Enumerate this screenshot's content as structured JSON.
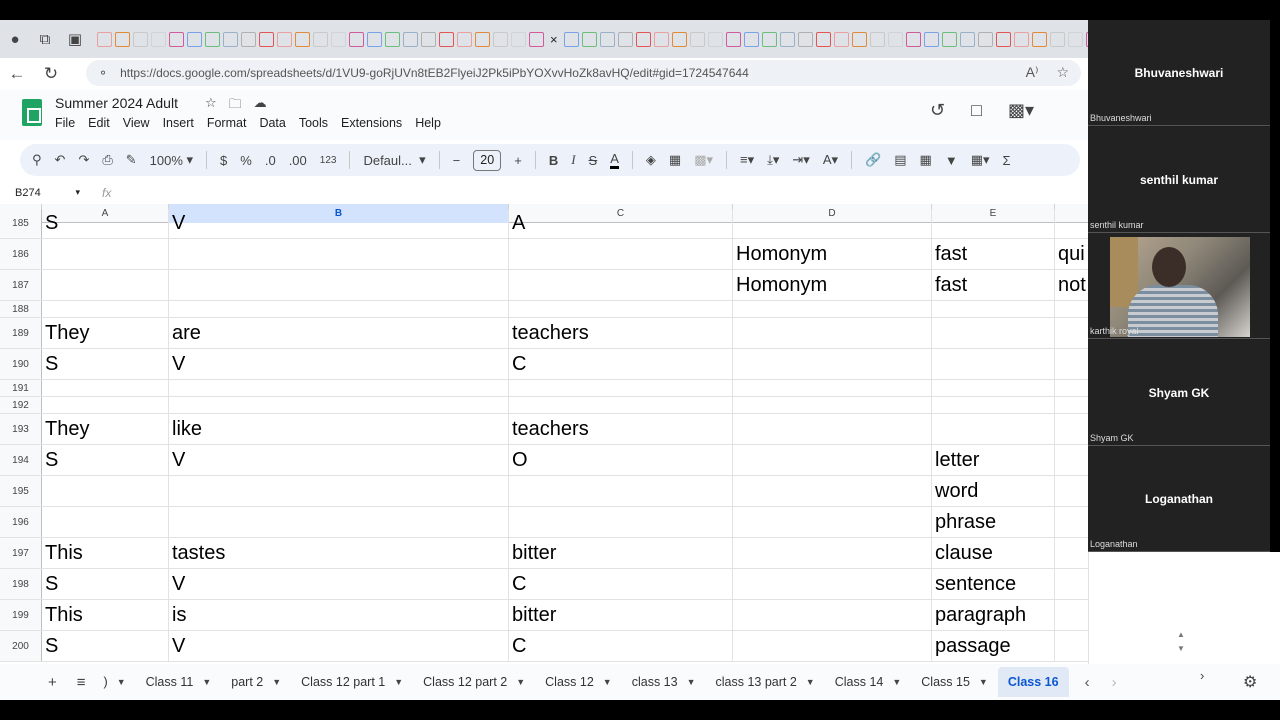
{
  "browser": {
    "url": "https://docs.google.com/spreadsheets/d/1VU9-goRjUVn8tEB2FlyeiJ2Pk5iPbYOXvvHoZk8avHQ/edit#gid=1724547644",
    "tab_close": "×"
  },
  "doc": {
    "title": "Summer 2024 Adult",
    "menu": [
      "File",
      "Edit",
      "View",
      "Insert",
      "Format",
      "Data",
      "Tools",
      "Extensions",
      "Help"
    ]
  },
  "toolbar": {
    "zoom": "100%",
    "currency": "$",
    "percent": "%",
    "dec_decrease": ".0",
    "dec_increase": ".00",
    "number_format": "123",
    "font": "Defaul...",
    "font_size": "20",
    "bold": "B",
    "italic": "I",
    "strike": "S",
    "text_color": "A"
  },
  "formula_bar": {
    "cell_ref": "B274",
    "fx": "fx",
    "value": ""
  },
  "grid": {
    "columns": [
      {
        "label": "A",
        "selected": false
      },
      {
        "label": "B",
        "selected": true
      },
      {
        "label": "C",
        "selected": false
      },
      {
        "label": "D",
        "selected": false
      },
      {
        "label": "E",
        "selected": false
      },
      {
        "label": "",
        "selected": false
      }
    ],
    "rows": [
      {
        "num": "185",
        "cells": [
          "S",
          "V",
          "A",
          "",
          "",
          ""
        ]
      },
      {
        "num": "186",
        "cells": [
          "",
          "",
          "",
          "Homonym",
          "fast",
          "qui"
        ]
      },
      {
        "num": "187",
        "cells": [
          "",
          "",
          "",
          "Homonym",
          "fast",
          "not"
        ]
      },
      {
        "num": "188",
        "cells": [
          "",
          "",
          "",
          "",
          "",
          ""
        ]
      },
      {
        "num": "189",
        "cells": [
          "They",
          "are",
          "teachers",
          "",
          "",
          ""
        ]
      },
      {
        "num": "190",
        "cells": [
          "S",
          "V",
          "C",
          "",
          "",
          ""
        ]
      },
      {
        "num": "191",
        "cells": [
          "",
          "",
          "",
          "",
          "",
          ""
        ]
      },
      {
        "num": "192",
        "cells": [
          "",
          "",
          "",
          "",
          "",
          ""
        ]
      },
      {
        "num": "193",
        "cells": [
          "They",
          "like",
          "teachers",
          "",
          "",
          ""
        ]
      },
      {
        "num": "194",
        "cells": [
          "S",
          "V",
          "O",
          "",
          "letter",
          ""
        ]
      },
      {
        "num": "195",
        "cells": [
          "",
          "",
          "",
          "",
          "word",
          ""
        ]
      },
      {
        "num": "196",
        "cells": [
          "",
          "",
          "",
          "",
          "phrase",
          ""
        ]
      },
      {
        "num": "197",
        "cells": [
          "This",
          "tastes",
          "bitter",
          "",
          "clause",
          ""
        ]
      },
      {
        "num": "198",
        "cells": [
          "S",
          "V",
          "C",
          "",
          "sentence",
          ""
        ]
      },
      {
        "num": "199",
        "cells": [
          "This",
          "is",
          "bitter",
          "",
          "paragraph",
          ""
        ]
      },
      {
        "num": "200",
        "cells": [
          "S",
          "V",
          "C",
          "",
          "passage",
          ""
        ]
      }
    ]
  },
  "sheets": {
    "tabs": [
      {
        "label": ")",
        "active": false
      },
      {
        "label": "Class 11",
        "active": false
      },
      {
        "label": "part 2",
        "active": false
      },
      {
        "label": "Class 12 part 1",
        "active": false
      },
      {
        "label": "Class 12 part 2",
        "active": false
      },
      {
        "label": "Class 12",
        "active": false
      },
      {
        "label": "class 13",
        "active": false
      },
      {
        "label": "class 13 part 2",
        "active": false
      },
      {
        "label": "Class 14",
        "active": false
      },
      {
        "label": "Class 15",
        "active": false
      },
      {
        "label": "Class 16",
        "active": true
      }
    ]
  },
  "meeting": {
    "participants": [
      {
        "name": "Bhuvaneshwari",
        "label": "Bhuvaneshwari",
        "video": false
      },
      {
        "name": "senthil kumar",
        "label": "senthil kumar",
        "video": false
      },
      {
        "name": "",
        "label": "karthik royal",
        "video": true
      },
      {
        "name": "Shyam GK",
        "label": "Shyam GK",
        "video": false
      },
      {
        "name": "Loganathan",
        "label": "Loganathan",
        "video": false
      }
    ]
  },
  "colors": {
    "accent": "#0b57d0",
    "sheets_green": "#1fa463",
    "selected_col": "#d3e3fd"
  }
}
